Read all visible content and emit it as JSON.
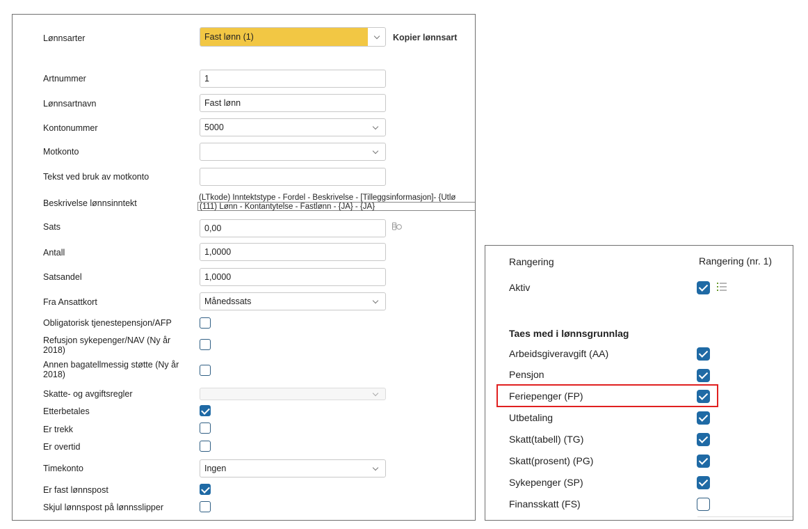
{
  "left": {
    "lonnsarter_label": "Lønnsarter",
    "lonnsart_selected": "Fast lønn (1)",
    "kopier_label": "Kopier lønnsart",
    "fields": {
      "artnummer": {
        "label": "Artnummer",
        "value": "1"
      },
      "lonnsartnavn": {
        "label": "Lønnsartnavn",
        "value": "Fast lønn"
      },
      "kontonummer": {
        "label": "Kontonummer",
        "value": "5000"
      },
      "motkonto": {
        "label": "Motkonto",
        "value": ""
      },
      "tekst_motkonto": {
        "label": "Tekst ved bruk av motkonto",
        "value": ""
      },
      "beskrivelse": {
        "label": "Beskrivelse lønnsinntekt",
        "line1": "(LTkode) Inntektstype - Fordel - Beskrivelse - [Tilleggsinformasjon]- {Utlø",
        "line2": "(111) Lønn - Kontantytelse - Fastlønn - {JA} - {JA}"
      },
      "sats": {
        "label": "Sats",
        "value": "0,00"
      },
      "antall": {
        "label": "Antall",
        "value": "1,0000"
      },
      "satsandel": {
        "label": "Satsandel",
        "value": "1,0000"
      },
      "fra_ansattkort": {
        "label": "Fra Ansattkort",
        "value": "Månedssats"
      },
      "obligatorisk": {
        "label": "Obligatorisk tjenestepensjon/AFP",
        "checked": false
      },
      "refusjon": {
        "label": "Refusjon sykepenger/NAV (Ny år 2018)",
        "checked": false
      },
      "annen": {
        "label": "Annen bagatellmessig støtte (Ny år 2018)",
        "checked": false
      },
      "skatte": {
        "label": "Skatte- og avgiftsregler",
        "value": ""
      },
      "etterbetales": {
        "label": "Etterbetales",
        "checked": true
      },
      "er_trekk": {
        "label": "Er trekk",
        "checked": false
      },
      "er_overtid": {
        "label": "Er overtid",
        "checked": false
      },
      "timekonto": {
        "label": "Timekonto",
        "value": "Ingen"
      },
      "er_fast": {
        "label": "Er fast lønnspost",
        "checked": true
      },
      "skjul": {
        "label": "Skjul lønnspost på lønnsslipper",
        "checked": false
      }
    }
  },
  "right": {
    "rangering_label": "Rangering",
    "rangering_value": "Rangering (nr. 1)",
    "aktiv_label": "Aktiv",
    "aktiv_checked": true,
    "section_title": "Taes med i lønnsgrunnlag",
    "items": [
      {
        "label": "Arbeidsgiveravgift (AA)",
        "checked": true
      },
      {
        "label": "Pensjon",
        "checked": true
      },
      {
        "label": "Feriepenger (FP)",
        "checked": true
      },
      {
        "label": "Utbetaling",
        "checked": true
      },
      {
        "label": "Skatt(tabell) (TG)",
        "checked": true
      },
      {
        "label": "Skatt(prosent) (PG)",
        "checked": true
      },
      {
        "label": "Sykepenger (SP)",
        "checked": true
      },
      {
        "label": "Finansskatt (FS)",
        "checked": false
      }
    ]
  },
  "colors": {
    "accent_yellow": "#f2c744",
    "checkbox_blue": "#1f6aa5",
    "highlight_red": "#e02020"
  }
}
